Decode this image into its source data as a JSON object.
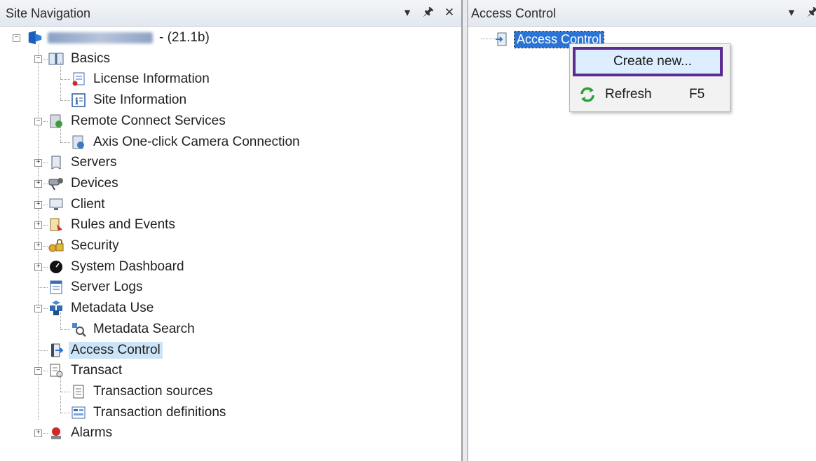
{
  "left_panel": {
    "title": "Site Navigation",
    "controls": [
      "dropdown-icon",
      "pin-icon",
      "close-icon"
    ],
    "root": {
      "name_blurred": true,
      "suffix": "- (21.1b)"
    },
    "tree": [
      {
        "label": "Basics",
        "icon": "book-icon",
        "level": 1,
        "toggle": "minus"
      },
      {
        "label": "License Information",
        "icon": "license-icon",
        "level": 2
      },
      {
        "label": "Site Information",
        "icon": "info-icon",
        "level": 2
      },
      {
        "label": "Remote Connect Services",
        "icon": "remote-connect-icon",
        "level": 1,
        "toggle": "minus"
      },
      {
        "label": "Axis One-click Camera Connection",
        "icon": "camera-connection-icon",
        "level": 2
      },
      {
        "label": "Servers",
        "icon": "server-icon",
        "level": 1,
        "toggle": "plus"
      },
      {
        "label": "Devices",
        "icon": "devices-icon",
        "level": 1,
        "toggle": "plus"
      },
      {
        "label": "Client",
        "icon": "client-icon",
        "level": 1,
        "toggle": "plus"
      },
      {
        "label": "Rules and Events",
        "icon": "rules-icon",
        "level": 1,
        "toggle": "plus"
      },
      {
        "label": "Security",
        "icon": "security-icon",
        "level": 1,
        "toggle": "plus"
      },
      {
        "label": "System Dashboard",
        "icon": "dashboard-icon",
        "level": 1,
        "toggle": "plus"
      },
      {
        "label": "Server Logs",
        "icon": "logs-icon",
        "level": 1
      },
      {
        "label": "Metadata Use",
        "icon": "metadata-icon",
        "level": 1,
        "toggle": "minus"
      },
      {
        "label": "Metadata Search",
        "icon": "metadata-search-icon",
        "level": 2
      },
      {
        "label": "Access Control",
        "icon": "access-control-icon",
        "level": 1,
        "selected": true
      },
      {
        "label": "Transact",
        "icon": "transact-icon",
        "level": 1,
        "toggle": "minus"
      },
      {
        "label": "Transaction sources",
        "icon": "transaction-sources-icon",
        "level": 2
      },
      {
        "label": "Transaction definitions",
        "icon": "transaction-definitions-icon",
        "level": 2
      },
      {
        "label": "Alarms",
        "icon": "alarms-icon",
        "level": 1,
        "toggle": "plus"
      }
    ]
  },
  "right_panel": {
    "title": "Access Control",
    "controls": [
      "dropdown-icon",
      "pin-icon"
    ],
    "root": {
      "label": "Access Control",
      "icon": "access-control-icon",
      "selected": true
    }
  },
  "context_menu": {
    "items": [
      {
        "label": "Create new...",
        "highlighted": true
      },
      {
        "label": "Refresh",
        "shortcut": "F5",
        "icon": "refresh-icon"
      }
    ]
  },
  "colors": {
    "selection": "#cce4f7",
    "highlight_border": "#5c2d91",
    "title_bg": "#e9edf3"
  }
}
